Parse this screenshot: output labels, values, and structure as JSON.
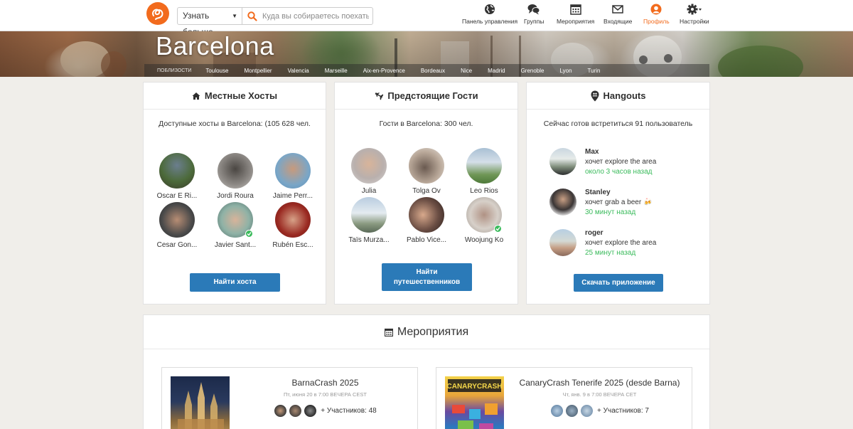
{
  "header": {
    "learn_more": "Узнать больше",
    "search_placeholder": "Куда вы собираетесь поехать?",
    "nav": [
      {
        "label": "Панель управления",
        "icon": "globe-icon"
      },
      {
        "label": "Группы",
        "icon": "chat-bubbles-icon"
      },
      {
        "label": "Мероприятия",
        "icon": "calendar-icon"
      },
      {
        "label": "Входящие",
        "icon": "envelope-icon"
      },
      {
        "label": "Профиль",
        "icon": "profile-icon"
      },
      {
        "label": "Настройки",
        "icon": "gear-icon"
      }
    ],
    "accent": "#f26b1d"
  },
  "banner": {
    "city": "Barcelona",
    "nearby_label": "ПОБЛИЗОСТИ",
    "nearby": [
      "Toulouse",
      "Montpellier",
      "Valencia",
      "Marseille",
      "Aix-en-Provence",
      "Bordeaux",
      "Nice",
      "Madrid",
      "Grenoble",
      "Lyon",
      "Turin"
    ]
  },
  "hosts": {
    "title": "Местные Хосты",
    "subtitle": "Доступные хосты в Barcelona: (105 628 чел.",
    "people": [
      "Oscar E Ri...",
      "Jordi Roura",
      "Jaime Perr...",
      "Cesar Gon...",
      "Javier Sant...",
      "Rubén Esc..."
    ],
    "button": "Найти хоста"
  },
  "guests": {
    "title": "Предстоящие Гости",
    "subtitle": "Гости в Barcelona: 300 чел.",
    "people": [
      "Julia",
      "Tolga Ov",
      "Leo Rios",
      "Taïs Murza...",
      "Pablo Vice...",
      "Woojung Ko"
    ],
    "button": "Найти путешественников"
  },
  "hangouts": {
    "title": "Hangouts",
    "subtitle": "Сейчас готов встретиться 91 пользователь",
    "items": [
      {
        "name": "Max",
        "activity": "хочет explore the area",
        "time": "около 3 часов назад"
      },
      {
        "name": "Stanley",
        "activity": "хочет grab a beer 🍻",
        "time": "30 минут назад"
      },
      {
        "name": "roger",
        "activity": "хочет explore the area",
        "time": "25 минут назад"
      }
    ],
    "button": "Скачать приложение"
  },
  "events": {
    "title": "Мероприятия",
    "items": [
      {
        "title": "BarnaCrash 2025",
        "date": "Пт, июня 20 в 7:00 ВЕЧЕРА CEST",
        "participants": "+ Участников: 48"
      },
      {
        "title": "CanaryCrash Tenerife 2025 (desde Barna)",
        "date": "Чт, янв. 9 в 7:00 ВЕЧЕРА CET",
        "participants": "+ Участников: 7",
        "poster_text": "CANARYCRASH"
      }
    ]
  }
}
